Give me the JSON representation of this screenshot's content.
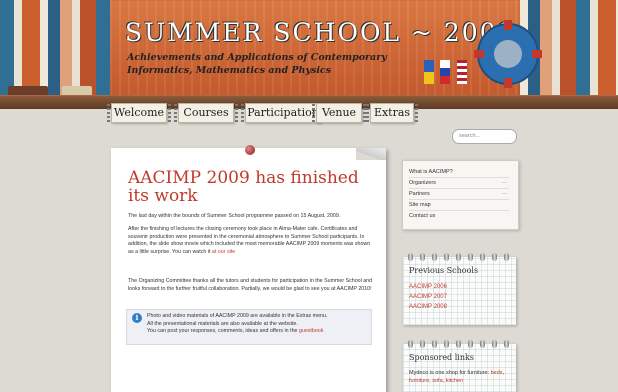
{
  "header": {
    "site_title": "SUMMER SCHOOL ~ 2009",
    "subtitle": "Achievements and Applications of Contemporary Informatics, Mathematics and Physics"
  },
  "nav": [
    {
      "label": "Welcome"
    },
    {
      "label": "Courses"
    },
    {
      "label": "Participation"
    },
    {
      "label": "Venue"
    },
    {
      "label": "Extras"
    }
  ],
  "search": {
    "placeholder": "search..."
  },
  "post": {
    "title": "AACIMP 2009 has finished its work",
    "p1": "The last day within the bounds of Summer School programme passed on 15 August, 2009.",
    "p2_text": "After the finishing of lectures the closing ceremony took place in Alma-Mater cafe. Certificates and souvenir production were presented in the ceremonial atmosphere to Summer School participants. In addition, the slide show movie which included the most memorable AACIMP 2009 moments was shown as a little surprise. You can watch it ",
    "p2_link": "at our site",
    "p3": "The Organizing Committee thanks all the tutors and students for participation in the Summer School and looks forward to the further fruitful collaboration. Partially, we would be glad to see you at AACIMP 2010!",
    "info_line1": "Photo and video materials of AACIMP 2009 are available in the Extras menu.",
    "info_line2": "All the presentational materials are also available at the website.",
    "info_line3": "You can post your responses, comments, ideas and offers in the ",
    "info_link": "guestbook"
  },
  "sidebar": {
    "menu": [
      {
        "label": "What is AACIMP?",
        "has_arrow": false
      },
      {
        "label": "Organizers",
        "has_arrow": true
      },
      {
        "label": "Partners",
        "has_arrow": true
      },
      {
        "label": "Site map",
        "has_arrow": false
      },
      {
        "label": "Contact us",
        "has_arrow": false
      }
    ],
    "previous": {
      "title": "Previous Schools",
      "items": [
        {
          "label": "AACIMP 2006"
        },
        {
          "label": "AACIMP 2007"
        },
        {
          "label": "AACIMP 2008"
        }
      ]
    },
    "sponsored": {
      "title": "Sponsored links",
      "text": "Mydeco is one shop for furniture: ",
      "links": [
        "beds",
        "furniture",
        "sofa",
        "kitchen"
      ]
    }
  }
}
